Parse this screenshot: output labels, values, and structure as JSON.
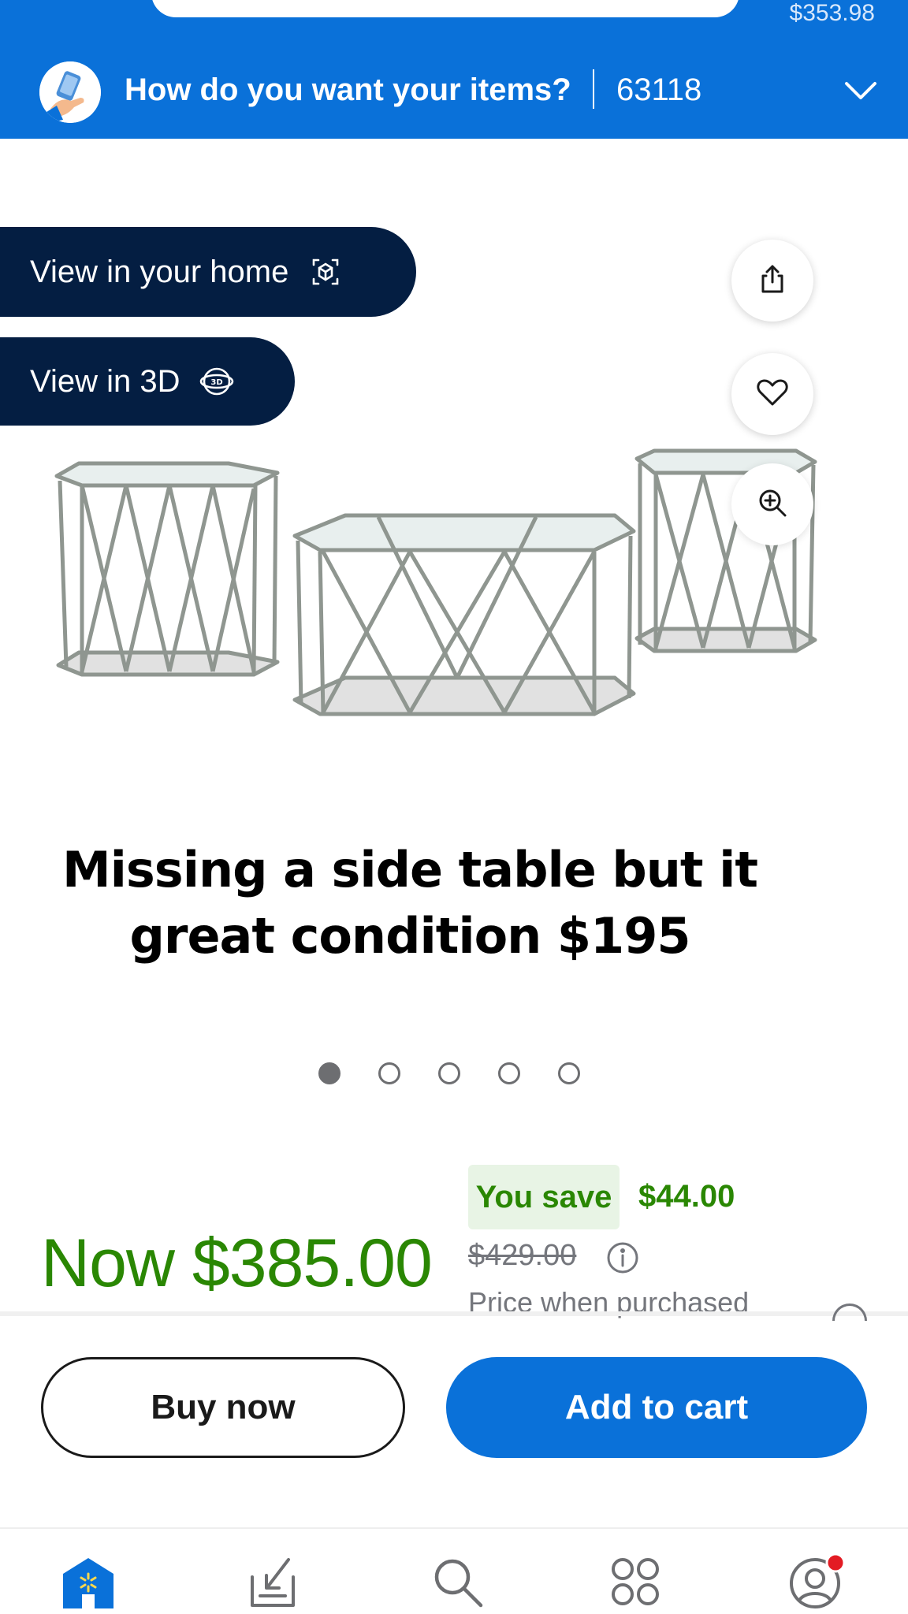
{
  "header": {
    "cart_total": "$353.98",
    "fulfillment_prompt": "How do you want your items?",
    "zip_code": "63118"
  },
  "media": {
    "view_home_label": "View in your home",
    "view_3d_label": "View in 3D",
    "caption_line1": "Missing a side table but it",
    "caption_line2": "great condition $195",
    "carousel_count": 5,
    "carousel_active": 0
  },
  "price": {
    "you_save_label": "You save",
    "save_amount": "$44.00",
    "now_price": "Now $385.00",
    "was_price": "$429.00",
    "price_note": "Price when purchased"
  },
  "actions": {
    "buy_now_label": "Buy now",
    "add_to_cart_label": "Add to cart"
  },
  "bottom_nav": {
    "items": [
      "home-icon",
      "my-items-icon",
      "search-icon",
      "services-icon",
      "account-icon"
    ],
    "active": "home-icon"
  },
  "colors": {
    "brand_blue": "#0a71d9",
    "navy": "#041e42",
    "savings_green": "#2a8703",
    "notification_red": "#e31b23"
  }
}
